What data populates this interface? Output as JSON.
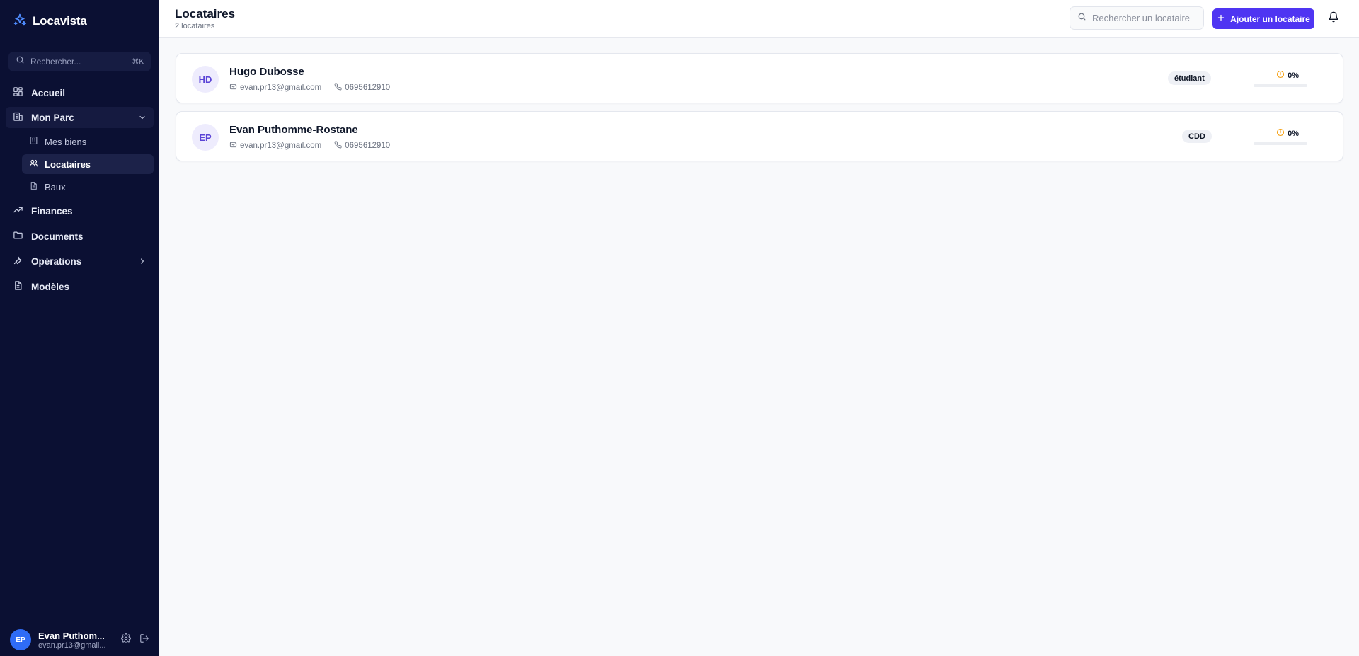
{
  "brand": {
    "name": "Locavista"
  },
  "sidebar": {
    "search": {
      "placeholder": "Rechercher...",
      "shortcut": "⌘K"
    },
    "items": [
      {
        "label": "Accueil",
        "icon": "dashboard-icon"
      },
      {
        "label": "Mon Parc",
        "icon": "building-icon",
        "expanded": true,
        "children": [
          {
            "label": "Mes biens",
            "icon": "bed-icon"
          },
          {
            "label": "Locataires",
            "icon": "users-icon",
            "active": true
          },
          {
            "label": "Baux",
            "icon": "document-icon"
          }
        ]
      },
      {
        "label": "Finances",
        "icon": "trend-up-icon"
      },
      {
        "label": "Documents",
        "icon": "folder-icon"
      },
      {
        "label": "Opérations",
        "icon": "wrench-icon"
      },
      {
        "label": "Modèles",
        "icon": "file-text-icon"
      }
    ],
    "user": {
      "initials": "EP",
      "name": "Evan Puthom...",
      "email": "evan.pr13@gmail..."
    }
  },
  "header": {
    "title": "Locataires",
    "subtitle": "2 locataires",
    "search_placeholder": "Rechercher un locataire",
    "add_label": "Ajouter un locataire"
  },
  "tenants": [
    {
      "initials": "HD",
      "name": "Hugo Dubosse",
      "email": "evan.pr13@gmail.com",
      "phone": "0695612910",
      "status": "étudiant",
      "score": "0%",
      "score_value": 0
    },
    {
      "initials": "EP",
      "name": "Evan Puthomme-Rostane",
      "email": "evan.pr13@gmail.com",
      "phone": "0695612910",
      "status": "CDD",
      "score": "0%",
      "score_value": 0
    }
  ],
  "colors": {
    "sidebar_bg": "#0b1033",
    "accent": "#4f35f2",
    "warning": "#f59e0b",
    "avatar_user": "#2f6cf6"
  }
}
